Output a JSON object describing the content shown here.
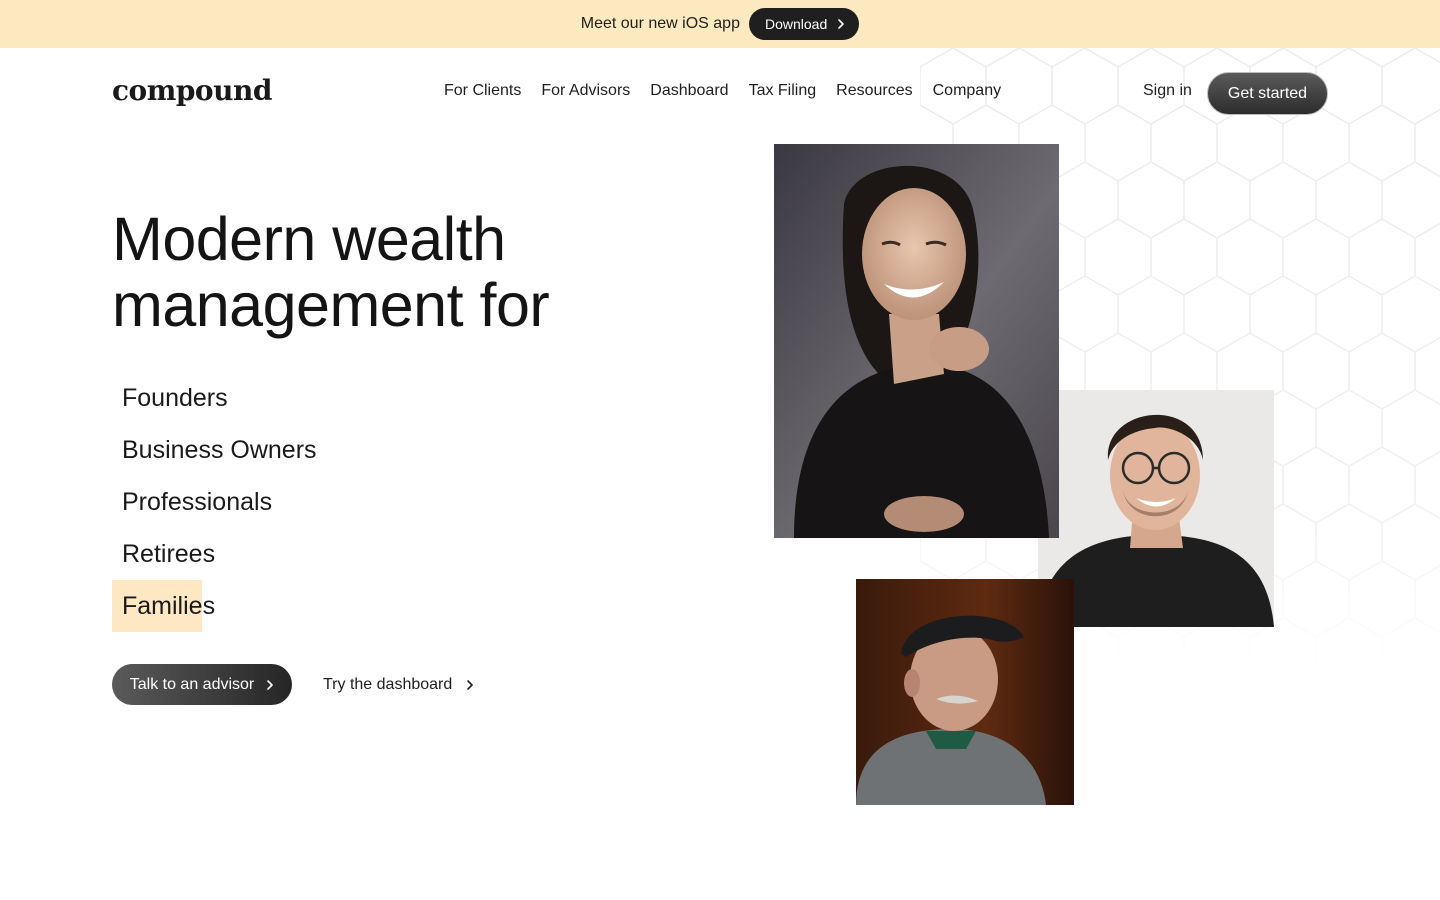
{
  "banner": {
    "text": "Meet our new iOS app",
    "button_label": "Download"
  },
  "nav": {
    "logo": "compound",
    "links": [
      "For Clients",
      "For Advisors",
      "Dashboard",
      "Tax Filing",
      "Resources",
      "Company"
    ],
    "sign_in": "Sign in",
    "get_started": "Get started"
  },
  "hero": {
    "title_line1": "Modern wealth",
    "title_line2": "management for",
    "audiences": [
      "Founders",
      "Business Owners",
      "Professionals",
      "Retirees",
      "Families"
    ],
    "active_audience": "Families",
    "primary_cta": "Talk to an advisor",
    "secondary_cta": "Try the dashboard"
  },
  "colors": {
    "banner_bg": "#fde9c0",
    "highlight": "#fde8c3",
    "button_dark": "#1f1f1f"
  },
  "icons": {
    "chevron": "chevron-right-icon"
  }
}
